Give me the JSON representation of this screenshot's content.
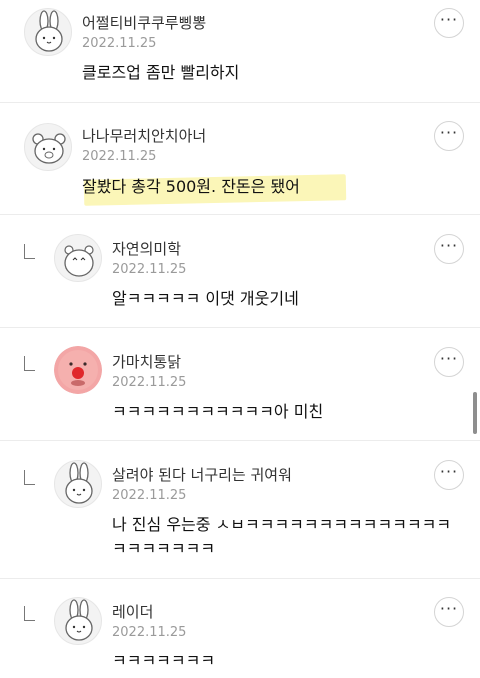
{
  "comments": [
    {
      "name": "어쩔티비쿠쿠루삥뽕",
      "date": "2022.11.25",
      "text": "클로즈업 좀만 빨리하지",
      "avatar": "rabbit-icon",
      "reply": false
    },
    {
      "name": "나나무러치안치아너",
      "date": "2022.11.25",
      "text": "잘봤다 총각 500원. 잔돈은 됐어",
      "avatar": "bear-icon",
      "reply": false
    },
    {
      "name": "자연의미학",
      "date": "2022.11.25",
      "text": "알ㅋㅋㅋㅋㅋ 이댓 개웃기네",
      "avatar": "hamster-icon",
      "reply": true
    },
    {
      "name": "가마치통닭",
      "date": "2022.11.25",
      "text": "ㅋㅋㅋㅋㅋㅋㅋㅋㅋㅋㅋ아 미친",
      "avatar": "red-nose-face-icon",
      "reply": true
    },
    {
      "name": "살려야 된다 너구리는 귀여워",
      "date": "2022.11.25",
      "text": "나 진심 우는중 ㅅㅂㅋㅋㅋㅋㅋㅋㅋㅋㅋㅋㅋㅋㅋㅋ",
      "text2": "ㅋㅋㅋㅋㅋㅋㅋ",
      "avatar": "rabbit-icon",
      "reply": true
    },
    {
      "name": "레이더",
      "date": "2022.11.25",
      "text": "ㅋㅋㅋㅋㅋㅋㅋ",
      "avatar": "rabbit-icon",
      "reply": true
    }
  ],
  "more_glyph": "···",
  "colors": {
    "highlight": "#fbf6b8",
    "divider": "#ececec",
    "date": "#9a9a9a"
  }
}
